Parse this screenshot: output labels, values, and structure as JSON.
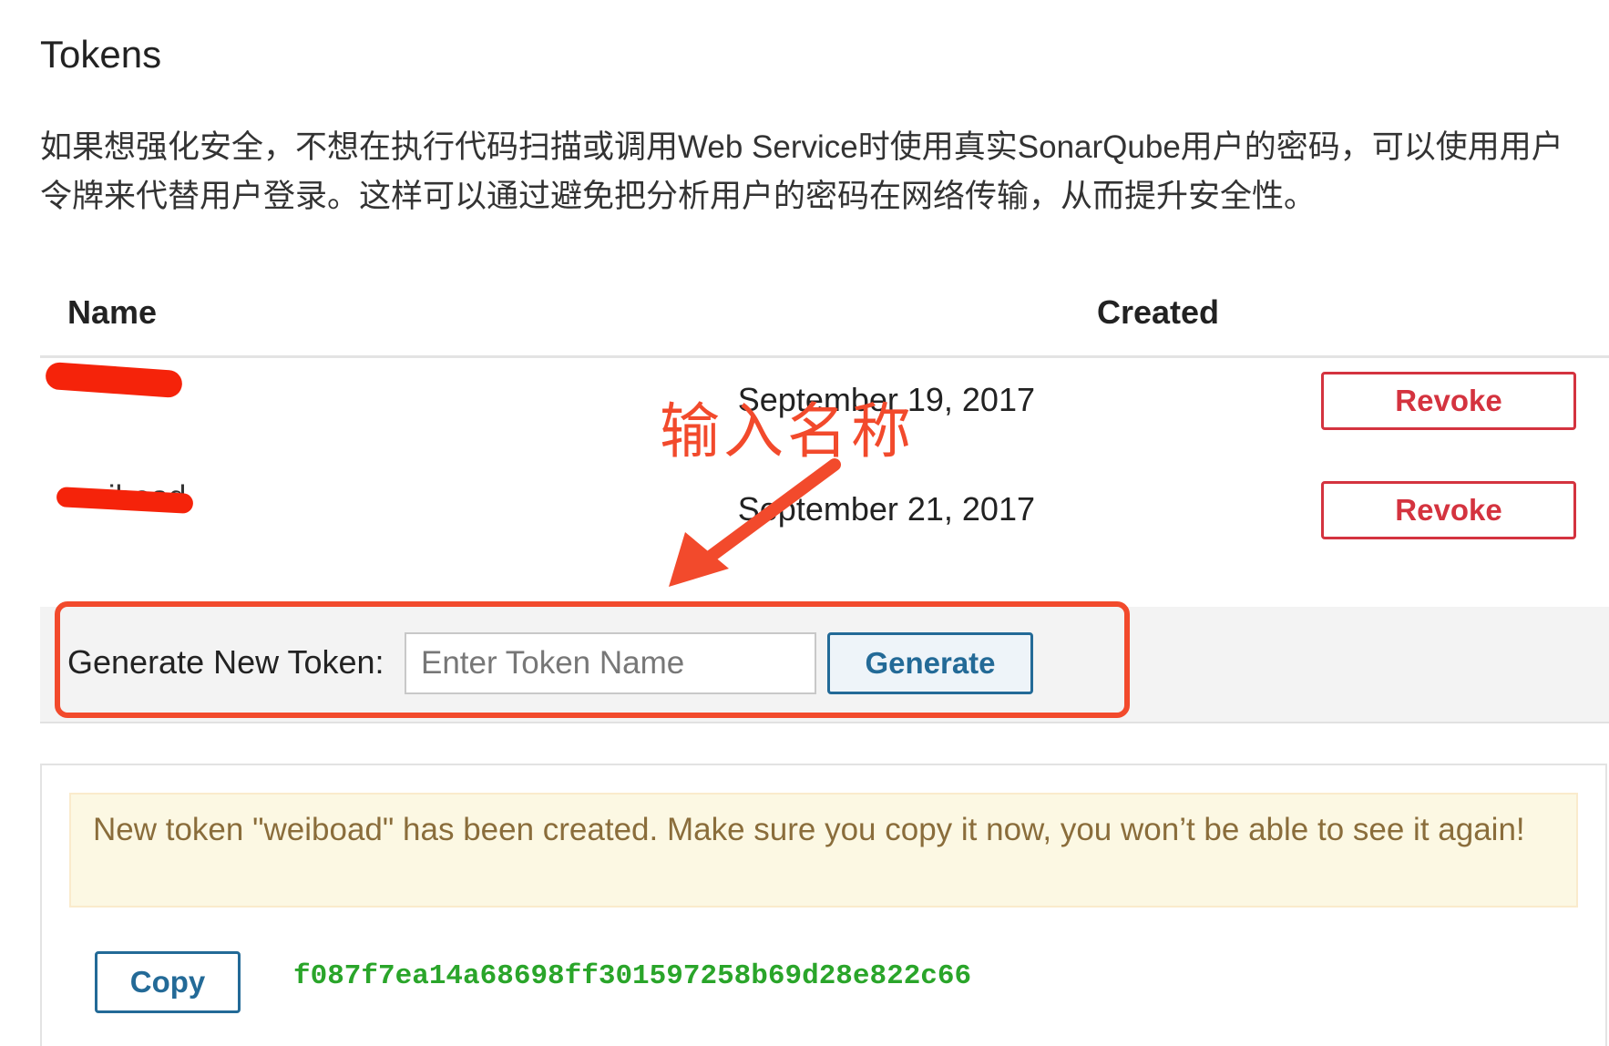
{
  "page": {
    "title": "Tokens",
    "description": "如果想强化安全，不想在执行代码扫描或调用Web Service时使用真实SonarQube用户的密码，可以使用用户令牌来代替用户登录。这样可以通过避免把分析用户的密码在网络传输，从而提升安全性。"
  },
  "table": {
    "headers": {
      "name": "Name",
      "created": "Created"
    },
    "rows": [
      {
        "name": "",
        "created": "September 19, 2017",
        "action": "Revoke"
      },
      {
        "name": "weiboad",
        "created": "September 21, 2017",
        "action": "Revoke"
      }
    ]
  },
  "generate": {
    "label": "Generate New Token:",
    "input_value": "",
    "input_placeholder": "Enter Token Name",
    "button_label": "Generate"
  },
  "annotation": {
    "text": "输入名称",
    "color": "#f24a2c"
  },
  "result": {
    "message": "New token \"weiboad\" has been created. Make sure you copy it now, you won’t be able to see it again!",
    "copy_label": "Copy",
    "token": "f087f7ea14a68698ff301597258b69d28e822c66"
  },
  "colors": {
    "revoke": "#d4333f",
    "primary": "#236a97",
    "token": "#2aa52a",
    "alert_bg": "#fcf8e3",
    "alert_text": "#8a6d3b"
  }
}
